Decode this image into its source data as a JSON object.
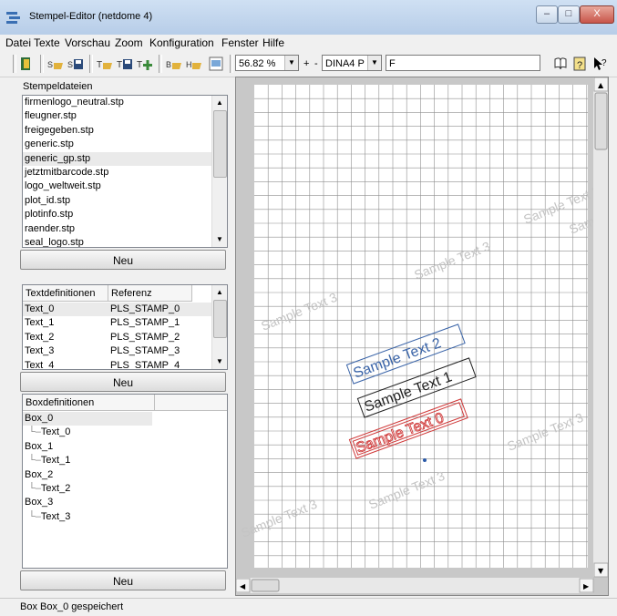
{
  "window": {
    "title": "Stempel-Editor (netdome 4)",
    "minimize": "–",
    "maximize": "□",
    "close": "X"
  },
  "menu": [
    "Datei",
    "Texte",
    "Vorschau",
    "Zoom",
    "Konfiguration",
    "Fenster",
    "Hilfe"
  ],
  "toolbar": {
    "zoom_value": "56.82 %",
    "zoom_plus": "+",
    "zoom_minus": "-",
    "paper_value": "DINA4 P",
    "orientation_value": "F",
    "icons": [
      "exit-icon",
      "open-stamp-icon",
      "save-stamp-icon",
      "open-text-icon",
      "save-text-icon",
      "add-text-icon",
      "open-box-icon",
      "add-box-icon",
      "preview-icon",
      "book-icon",
      "help-icon",
      "context-help-icon"
    ]
  },
  "stempeldateien": {
    "label": "Stempeldateien",
    "items": [
      "firmenlogo_neutral.stp",
      "fleugner.stp",
      "freigegeben.stp",
      "generic.stp",
      "generic_gp.stp",
      "jetztmitbarcode.stp",
      "logo_weltweit.stp",
      "plot_id.stp",
      "plotinfo.stp",
      "raender.stp",
      "seal_logo.stp"
    ],
    "selected_index": 4,
    "button": "Neu"
  },
  "textdefinitionen": {
    "columns": [
      "Textdefinitionen",
      "Referenz"
    ],
    "rows": [
      [
        "Text_0",
        "PLS_STAMP_0"
      ],
      [
        "Text_1",
        "PLS_STAMP_1"
      ],
      [
        "Text_2",
        "PLS_STAMP_2"
      ],
      [
        "Text_3",
        "PLS_STAMP_3"
      ],
      [
        "Text_4",
        "PLS_STAMP_4"
      ]
    ],
    "selected_index": 0,
    "button": "Neu"
  },
  "boxdefinitionen": {
    "column": "Boxdefinitionen",
    "tree": [
      {
        "box": "Box_0",
        "text": "Text_0"
      },
      {
        "box": "Box_1",
        "text": "Text_1"
      },
      {
        "box": "Box_2",
        "text": "Text_2"
      },
      {
        "box": "Box_3",
        "text": "Text_3"
      }
    ],
    "selected_index": 0,
    "button": "Neu"
  },
  "canvas": {
    "watermark_text": "Sample Text 3",
    "sample_texts": [
      {
        "text": "Sample Text 2",
        "color": "#3a64a8"
      },
      {
        "text": "Sample Text 1",
        "color": "#222222"
      },
      {
        "text": "Sample Text 0",
        "color": "#d03a3a"
      }
    ],
    "grid_color": "#8f8f8f"
  },
  "status": {
    "text": "Box Box_0 gespeichert"
  }
}
